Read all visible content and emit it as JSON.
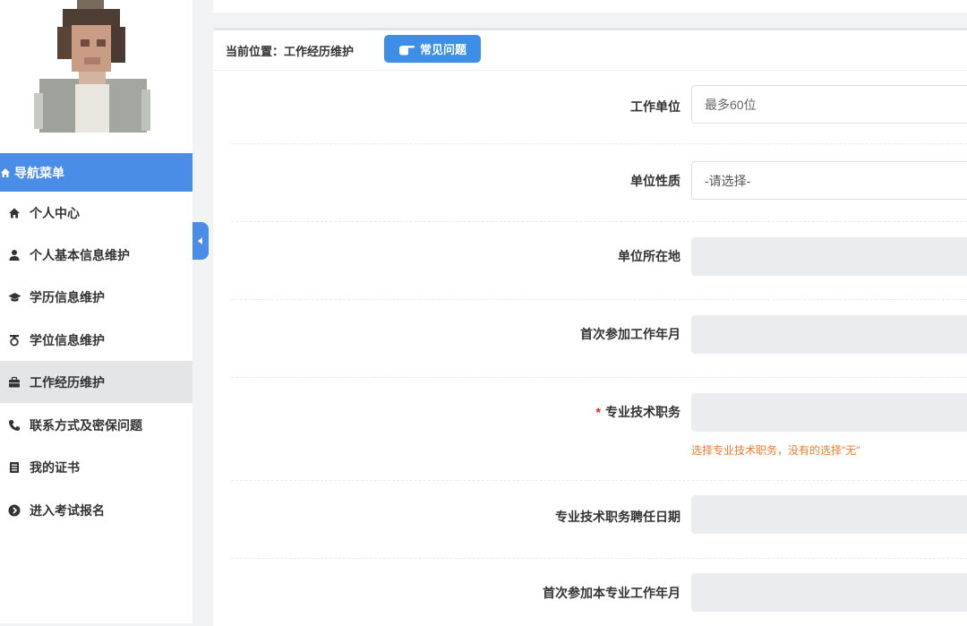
{
  "sidebar": {
    "menu_header": "导航菜单",
    "items": [
      {
        "label": "个人中心",
        "icon": "home-icon"
      },
      {
        "label": "个人基本信息维护",
        "icon": "user-icon"
      },
      {
        "label": "学历信息维护",
        "icon": "graduation-cap-icon"
      },
      {
        "label": "学位信息维护",
        "icon": "medal-icon"
      },
      {
        "label": "工作经历维护",
        "icon": "briefcase-icon",
        "active": true
      },
      {
        "label": "联系方式及密保问题",
        "icon": "phone-icon"
      },
      {
        "label": "我的证书",
        "icon": "certificate-icon"
      },
      {
        "label": "进入考试报名",
        "icon": "arrow-circle-icon"
      }
    ]
  },
  "breadcrumb": {
    "text": "当前位置：工作经历维护",
    "faq_label": "常见问题"
  },
  "form": {
    "fields": [
      {
        "label": "工作单位",
        "placeholder": "最多60位",
        "required": false
      },
      {
        "label": "单位性质",
        "selected": "-请选择-",
        "required": false
      },
      {
        "label": "单位所在地",
        "value": "",
        "required": false
      },
      {
        "label": "首次参加工作年月",
        "value": "",
        "required": false
      },
      {
        "label": "专业技术职务",
        "value": "",
        "required": true,
        "hint": "选择专业技术职务，没有的选择\"无\""
      },
      {
        "label": "专业技术职务聘任日期",
        "value": "",
        "required": false
      },
      {
        "label": "首次参加本专业工作年月",
        "value": "",
        "required": false
      }
    ]
  },
  "colors": {
    "accent": "#4a8de8",
    "active_bg": "#e4e5e7",
    "hint": "#f07a2a",
    "required": "#e02020"
  }
}
